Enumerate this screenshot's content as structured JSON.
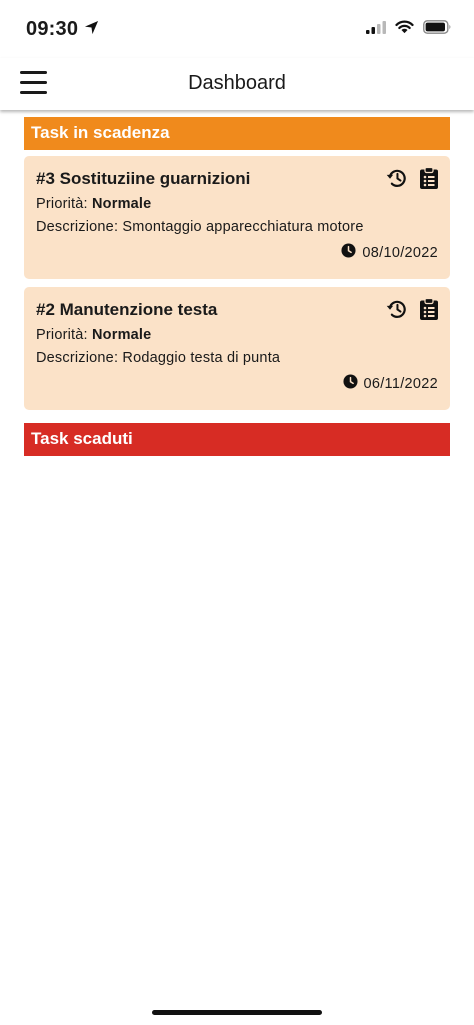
{
  "status_bar": {
    "time": "09:30"
  },
  "nav": {
    "title": "Dashboard"
  },
  "sections": {
    "due": {
      "title": "Task in scadenza"
    },
    "expired": {
      "title": "Task scaduti"
    }
  },
  "tasks": [
    {
      "title": "#3 Sostituziine guarnizioni",
      "priority_label": "Priorità:",
      "priority_value": "Normale",
      "description_label": "Descrizione:",
      "description_value": "Smontaggio apparecchiatura motore",
      "date": "08/10/2022"
    },
    {
      "title": "#2 Manutenzione testa",
      "priority_label": "Priorità:",
      "priority_value": "Normale",
      "description_label": "Descrizione:",
      "description_value": "Rodaggio testa di punta",
      "date": "06/11/2022"
    }
  ],
  "colors": {
    "due_header": "#f08a1c",
    "expired_header": "#d72c24",
    "card_background": "#fbe2c8"
  }
}
